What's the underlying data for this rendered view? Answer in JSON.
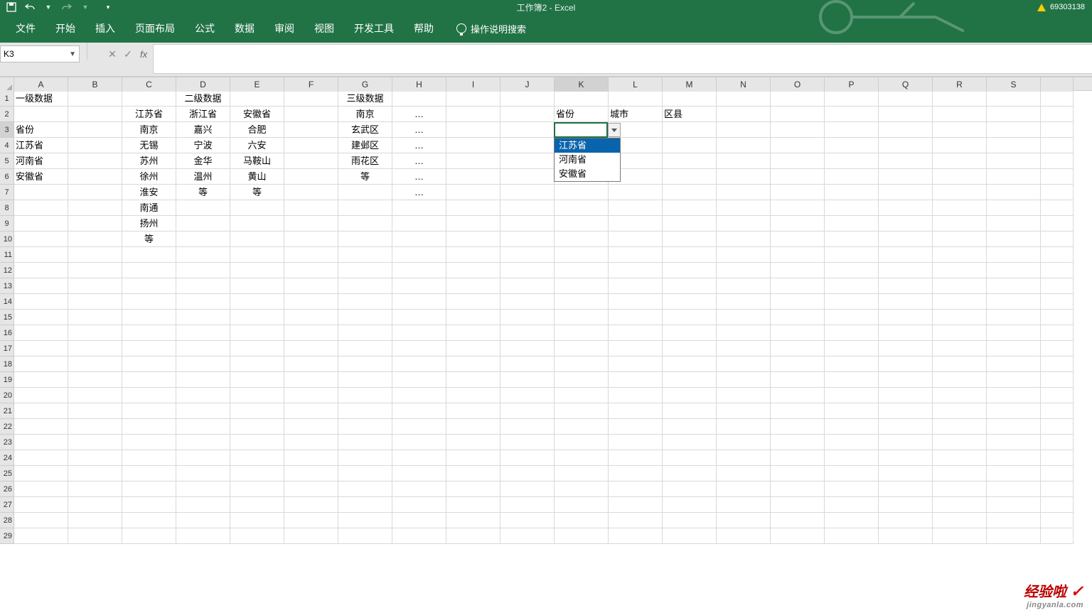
{
  "app": {
    "title": "工作簿2 - Excel",
    "userid": "69303138"
  },
  "qat": {
    "save": "保存",
    "undo": "撤销",
    "redo": "重做"
  },
  "ribbon": {
    "tabs": [
      "文件",
      "开始",
      "插入",
      "页面布局",
      "公式",
      "数据",
      "审阅",
      "视图",
      "开发工具",
      "帮助"
    ],
    "tell_me": "操作说明搜索"
  },
  "namebox": {
    "ref": "K3"
  },
  "fx": {
    "label": "fx"
  },
  "columns": [
    "A",
    "B",
    "C",
    "D",
    "E",
    "F",
    "G",
    "H",
    "I",
    "J",
    "K",
    "L",
    "M",
    "N",
    "O",
    "P",
    "Q",
    "R",
    "S",
    ""
  ],
  "row_numbers": [
    "1",
    "2",
    "3",
    "4",
    "5",
    "6",
    "7",
    "8",
    "9",
    "10",
    "11",
    "12",
    "13",
    "14",
    "15",
    "16",
    "17",
    "18",
    "19",
    "20",
    "21",
    "22",
    "23",
    "24",
    "25",
    "26",
    "27",
    "28",
    "29"
  ],
  "cells": {
    "A1": "一级数据",
    "D1": "二级数据",
    "G1": "三级数据",
    "C2": "江苏省",
    "D2": "浙江省",
    "E2": "安徽省",
    "G2": "南京",
    "H2": "…",
    "K2": "省份",
    "L2": "城市",
    "M2": "区县",
    "A3": "省份",
    "C3": "南京",
    "D3": "嘉兴",
    "E3": "合肥",
    "G3": "玄武区",
    "H3": "…",
    "A4": "江苏省",
    "C4": "无锡",
    "D4": "宁波",
    "E4": "六安",
    "G4": "建邺区",
    "H4": "…",
    "A5": "河南省",
    "C5": "苏州",
    "D5": "金华",
    "E5": "马鞍山",
    "G5": "雨花区",
    "H5": "…",
    "A6": "安徽省",
    "C6": "徐州",
    "D6": "温州",
    "E6": "黄山",
    "G6": "等",
    "H6": "…",
    "C7": "淮安",
    "D7": "等",
    "E7": "等",
    "H7": "…",
    "C8": "南通",
    "C9": "扬州",
    "C10": "等"
  },
  "dropdown": {
    "items": [
      "江苏省",
      "河南省",
      "安徽省"
    ],
    "selected_index": 0
  },
  "watermark": {
    "brand": "经验啦",
    "check": "✓",
    "url": "jingyanla.com"
  }
}
